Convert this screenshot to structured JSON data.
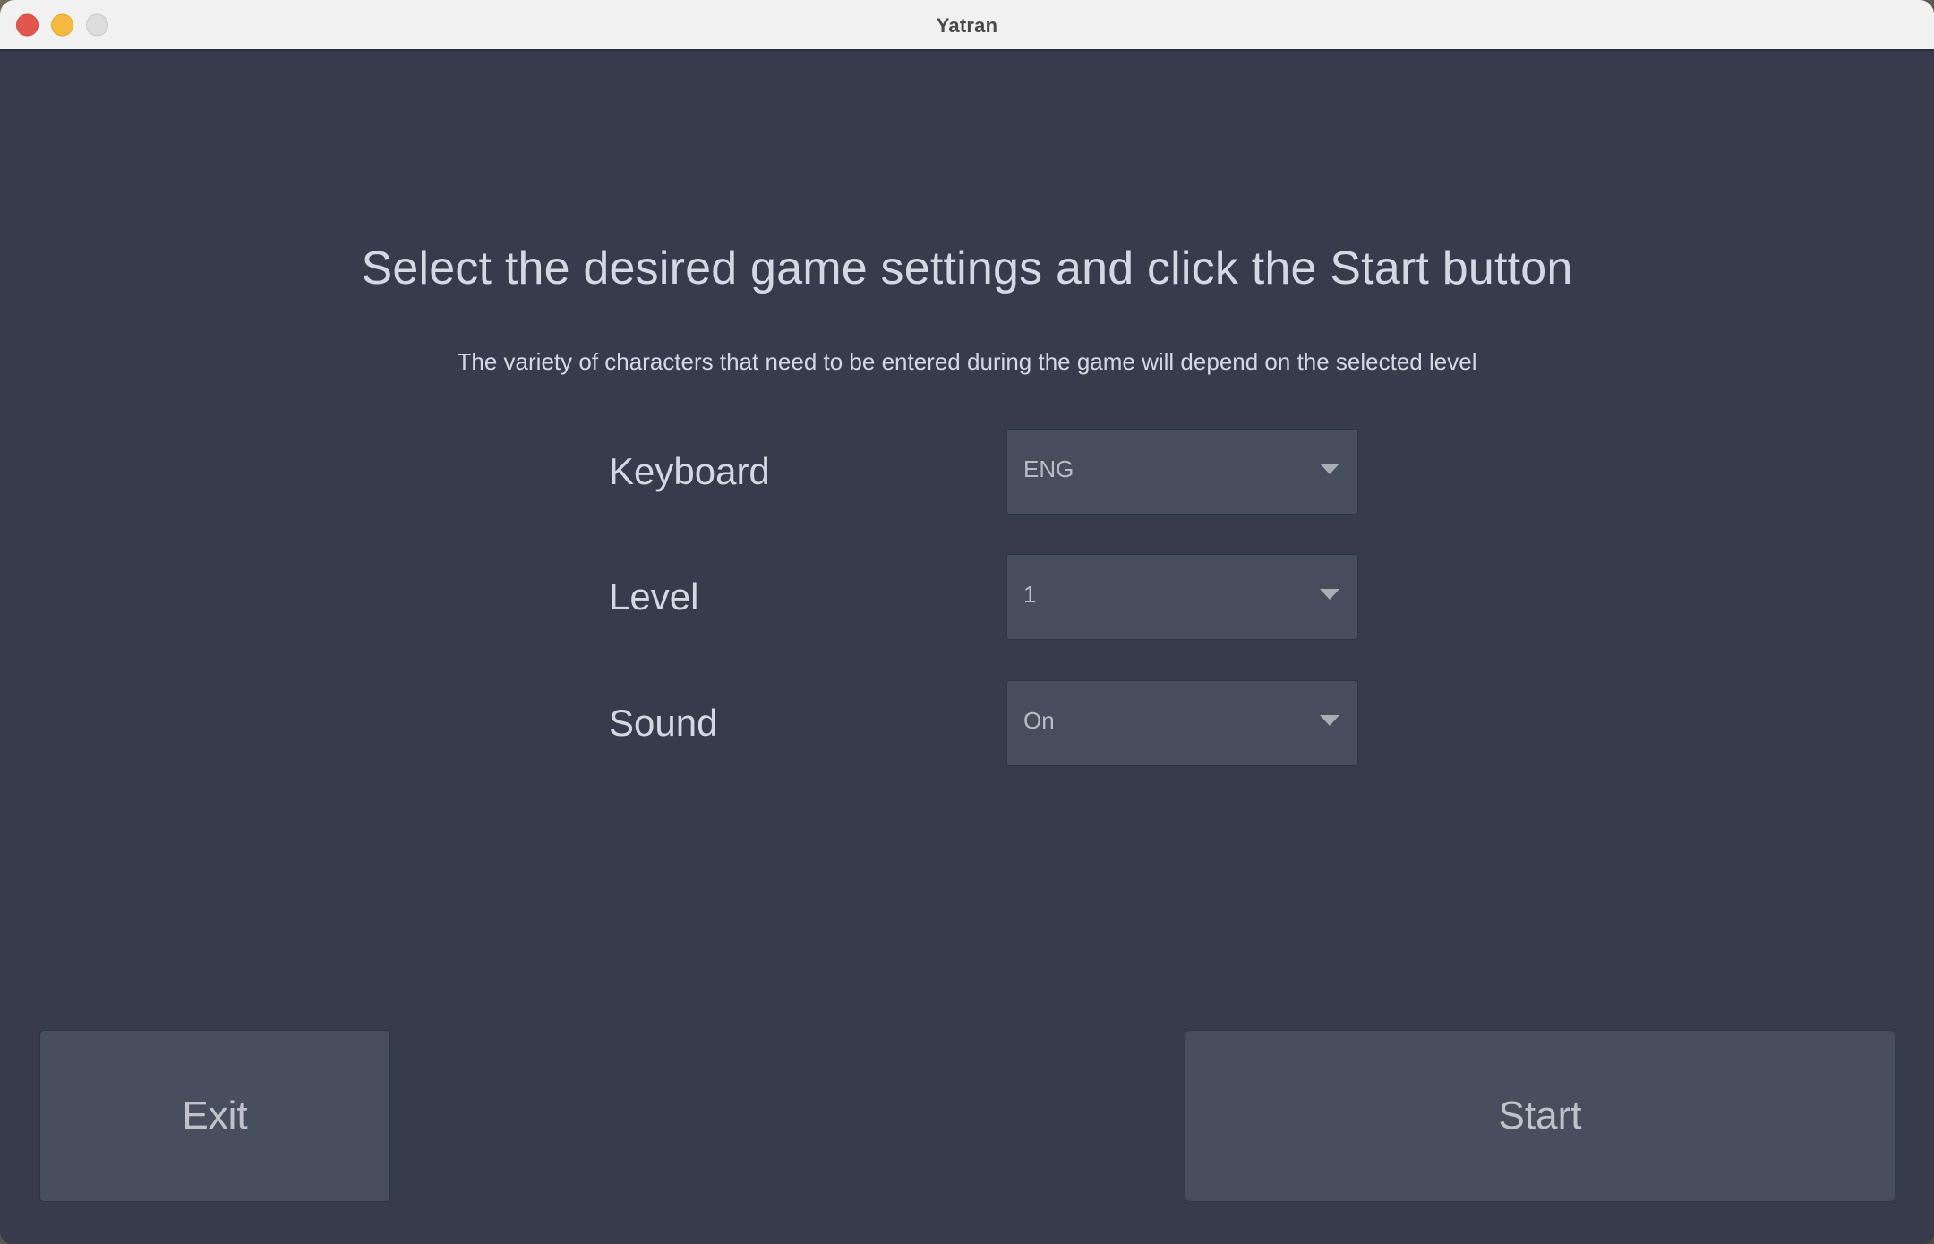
{
  "window": {
    "title": "Yatran",
    "traffic_lights": [
      {
        "name": "close",
        "color": "#e2564e"
      },
      {
        "name": "minimize",
        "color": "#f2bb3f"
      },
      {
        "name": "zoom",
        "color": "#dcdcdc"
      }
    ],
    "titlebar_bg": "#f1f1f1",
    "content_bg": "#373b4c"
  },
  "main": {
    "heading": "Select the desired game settings and click the Start button",
    "subheading": "The variety of characters that need to be entered during the game will depend on the selected level",
    "heading_color": "#d3d8e3"
  },
  "settings": [
    {
      "label": "Keyboard",
      "value": "ENG",
      "icon": "chevron-down-icon"
    },
    {
      "label": "Level",
      "value": "1",
      "icon": "chevron-down-icon"
    },
    {
      "label": "Sound",
      "value": "On",
      "icon": "chevron-down-icon"
    }
  ],
  "footer": {
    "exit_label": "Exit",
    "start_label": "Start",
    "button_bg": "#474e5e",
    "button_text_color": "#bfc2c8"
  }
}
